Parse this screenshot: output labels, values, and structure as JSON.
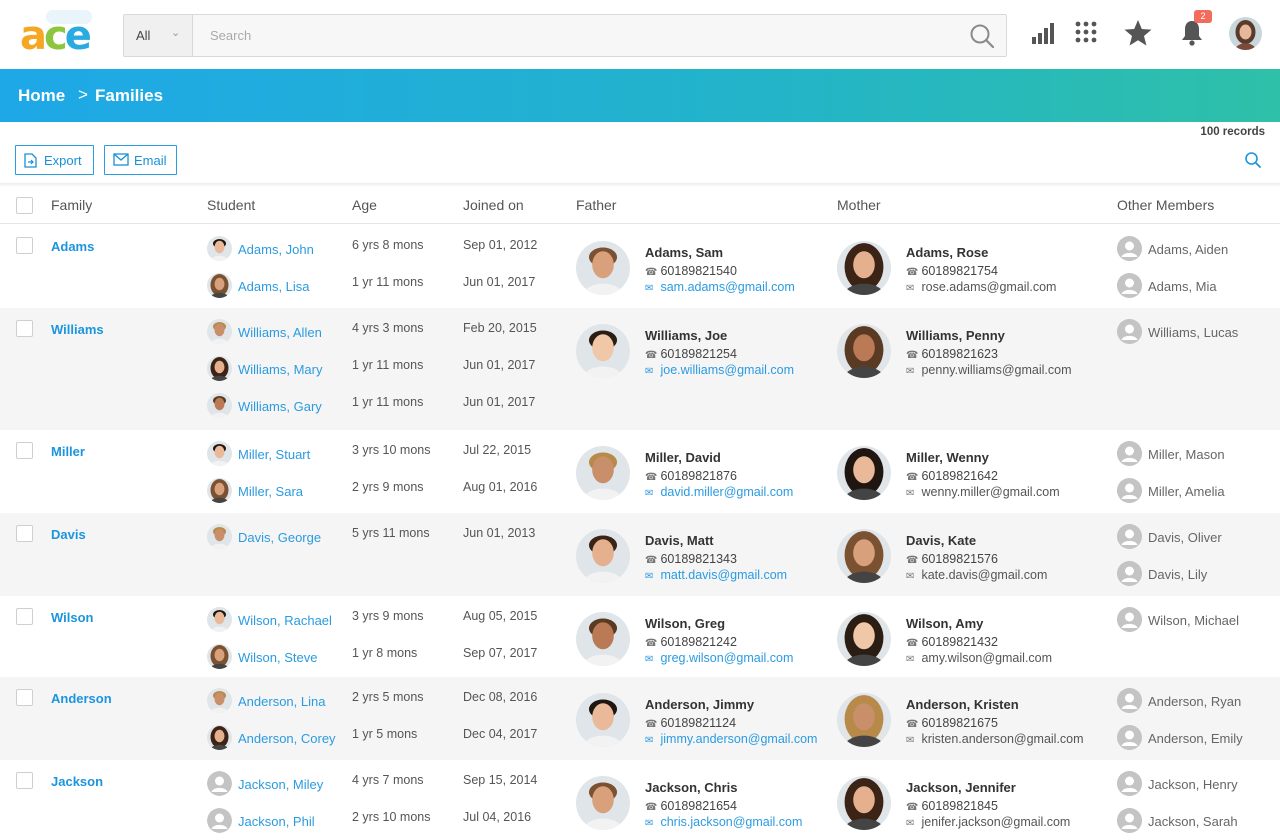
{
  "app": {
    "logo": "ace",
    "colors": {
      "accent": "#1b95de",
      "banner_start": "#1ea8e8",
      "banner_end": "#2ec0a8",
      "badge": "#f26b5b"
    }
  },
  "search": {
    "scope": "All",
    "placeholder": "Search",
    "value": ""
  },
  "header_icons": [
    "bar-chart-icon",
    "grid-apps-icon",
    "star-icon",
    "bell-icon",
    "avatar"
  ],
  "notifications": {
    "count": "2"
  },
  "breadcrumb": {
    "home": "Home",
    "separator": ">",
    "current": "Families"
  },
  "toolbar": {
    "records": "100 records",
    "export_label": "Export",
    "email_label": "Email"
  },
  "table": {
    "columns": [
      "Family",
      "Student",
      "Age",
      "Joined on",
      "Father",
      "Mother",
      "Other Members"
    ],
    "rows": [
      {
        "family": "Adams",
        "students": [
          {
            "name": "Adams, John",
            "age": "6 yrs 8 mons",
            "joined": "Sep 01, 2012"
          },
          {
            "name": "Adams, Lisa",
            "age": "1 yr 11 mons",
            "joined": "Jun 01, 2017"
          }
        ],
        "father": {
          "name": "Adams, Sam",
          "phone": "60189821540",
          "email": "sam.adams@gmail.com"
        },
        "mother": {
          "name": "Adams, Rose",
          "phone": "60189821754",
          "email": "rose.adams@gmail.com"
        },
        "others": [
          "Adams, Aiden",
          "Adams, Mia"
        ]
      },
      {
        "family": "Williams",
        "students": [
          {
            "name": "Williams, Allen",
            "age": "4 yrs 3 mons",
            "joined": "Feb 20, 2015"
          },
          {
            "name": "Williams, Mary",
            "age": "1 yr 11 mons",
            "joined": "Jun 01, 2017"
          },
          {
            "name": "Williams, Gary",
            "age": "1 yr 11 mons",
            "joined": "Jun 01, 2017"
          }
        ],
        "father": {
          "name": "Williams, Joe",
          "phone": "60189821254",
          "email": "joe.williams@gmail.com"
        },
        "mother": {
          "name": "Williams, Penny",
          "phone": "60189821623",
          "email": "penny.williams@gmail.com"
        },
        "others": [
          "Williams, Lucas"
        ]
      },
      {
        "family": "Miller",
        "students": [
          {
            "name": "Miller, Stuart",
            "age": "3 yrs 10 mons",
            "joined": "Jul 22, 2015"
          },
          {
            "name": "Miller, Sara",
            "age": "2 yrs 9 mons",
            "joined": "Aug 01, 2016"
          }
        ],
        "father": {
          "name": "Miller, David",
          "phone": "60189821876",
          "email": "david.miller@gmail.com"
        },
        "mother": {
          "name": "Miller, Wenny",
          "phone": "60189821642",
          "email": "wenny.miller@gmail.com"
        },
        "others": [
          "Miller, Mason",
          "Miller, Amelia"
        ]
      },
      {
        "family": "Davis",
        "students": [
          {
            "name": "Davis, George",
            "age": "5 yrs 11 mons",
            "joined": "Jun 01, 2013"
          }
        ],
        "father": {
          "name": "Davis, Matt",
          "phone": "60189821343",
          "email": "matt.davis@gmail.com"
        },
        "mother": {
          "name": "Davis, Kate",
          "phone": "60189821576",
          "email": "kate.davis@gmail.com"
        },
        "others": [
          "Davis, Oliver",
          "Davis, Lily"
        ]
      },
      {
        "family": "Wilson",
        "students": [
          {
            "name": "Wilson, Rachael",
            "age": "3 yrs 9 mons",
            "joined": "Aug 05, 2015"
          },
          {
            "name": "Wilson, Steve",
            "age": "1 yr 8 mons",
            "joined": "Sep 07, 2017"
          }
        ],
        "father": {
          "name": "Wilson, Greg",
          "phone": "60189821242",
          "email": "greg.wilson@gmail.com"
        },
        "mother": {
          "name": "Wilson, Amy",
          "phone": "60189821432",
          "email": "amy.wilson@gmail.com"
        },
        "others": [
          "Wilson, Michael"
        ]
      },
      {
        "family": "Anderson",
        "students": [
          {
            "name": "Anderson, Lina",
            "age": "2 yrs 5 mons",
            "joined": "Dec 08, 2016"
          },
          {
            "name": "Anderson, Corey",
            "age": "1 yr 5 mons",
            "joined": "Dec 04, 2017"
          }
        ],
        "father": {
          "name": "Anderson, Jimmy",
          "phone": "60189821124",
          "email": "jimmy.anderson@gmail.com"
        },
        "mother": {
          "name": "Anderson, Kristen",
          "phone": "60189821675",
          "email": "kristen.anderson@gmail.com"
        },
        "others": [
          "Anderson, Ryan",
          "Anderson, Emily"
        ]
      },
      {
        "family": "Jackson",
        "students": [
          {
            "name": "Jackson, Miley",
            "age": "4 yrs 7 mons",
            "joined": "Sep 15, 2014"
          },
          {
            "name": "Jackson, Phil",
            "age": "2 yrs 10 mons",
            "joined": "Jul 04, 2016"
          }
        ],
        "father": {
          "name": "Jackson, Chris",
          "phone": "60189821654",
          "email": "chris.jackson@gmail.com"
        },
        "mother": {
          "name": "Jackson, Jennifer",
          "phone": "60189821845",
          "email": "jenifer.jackson@gmail.com"
        },
        "others": [
          "Jackson, Henry",
          "Jackson, Sarah"
        ]
      }
    ]
  }
}
